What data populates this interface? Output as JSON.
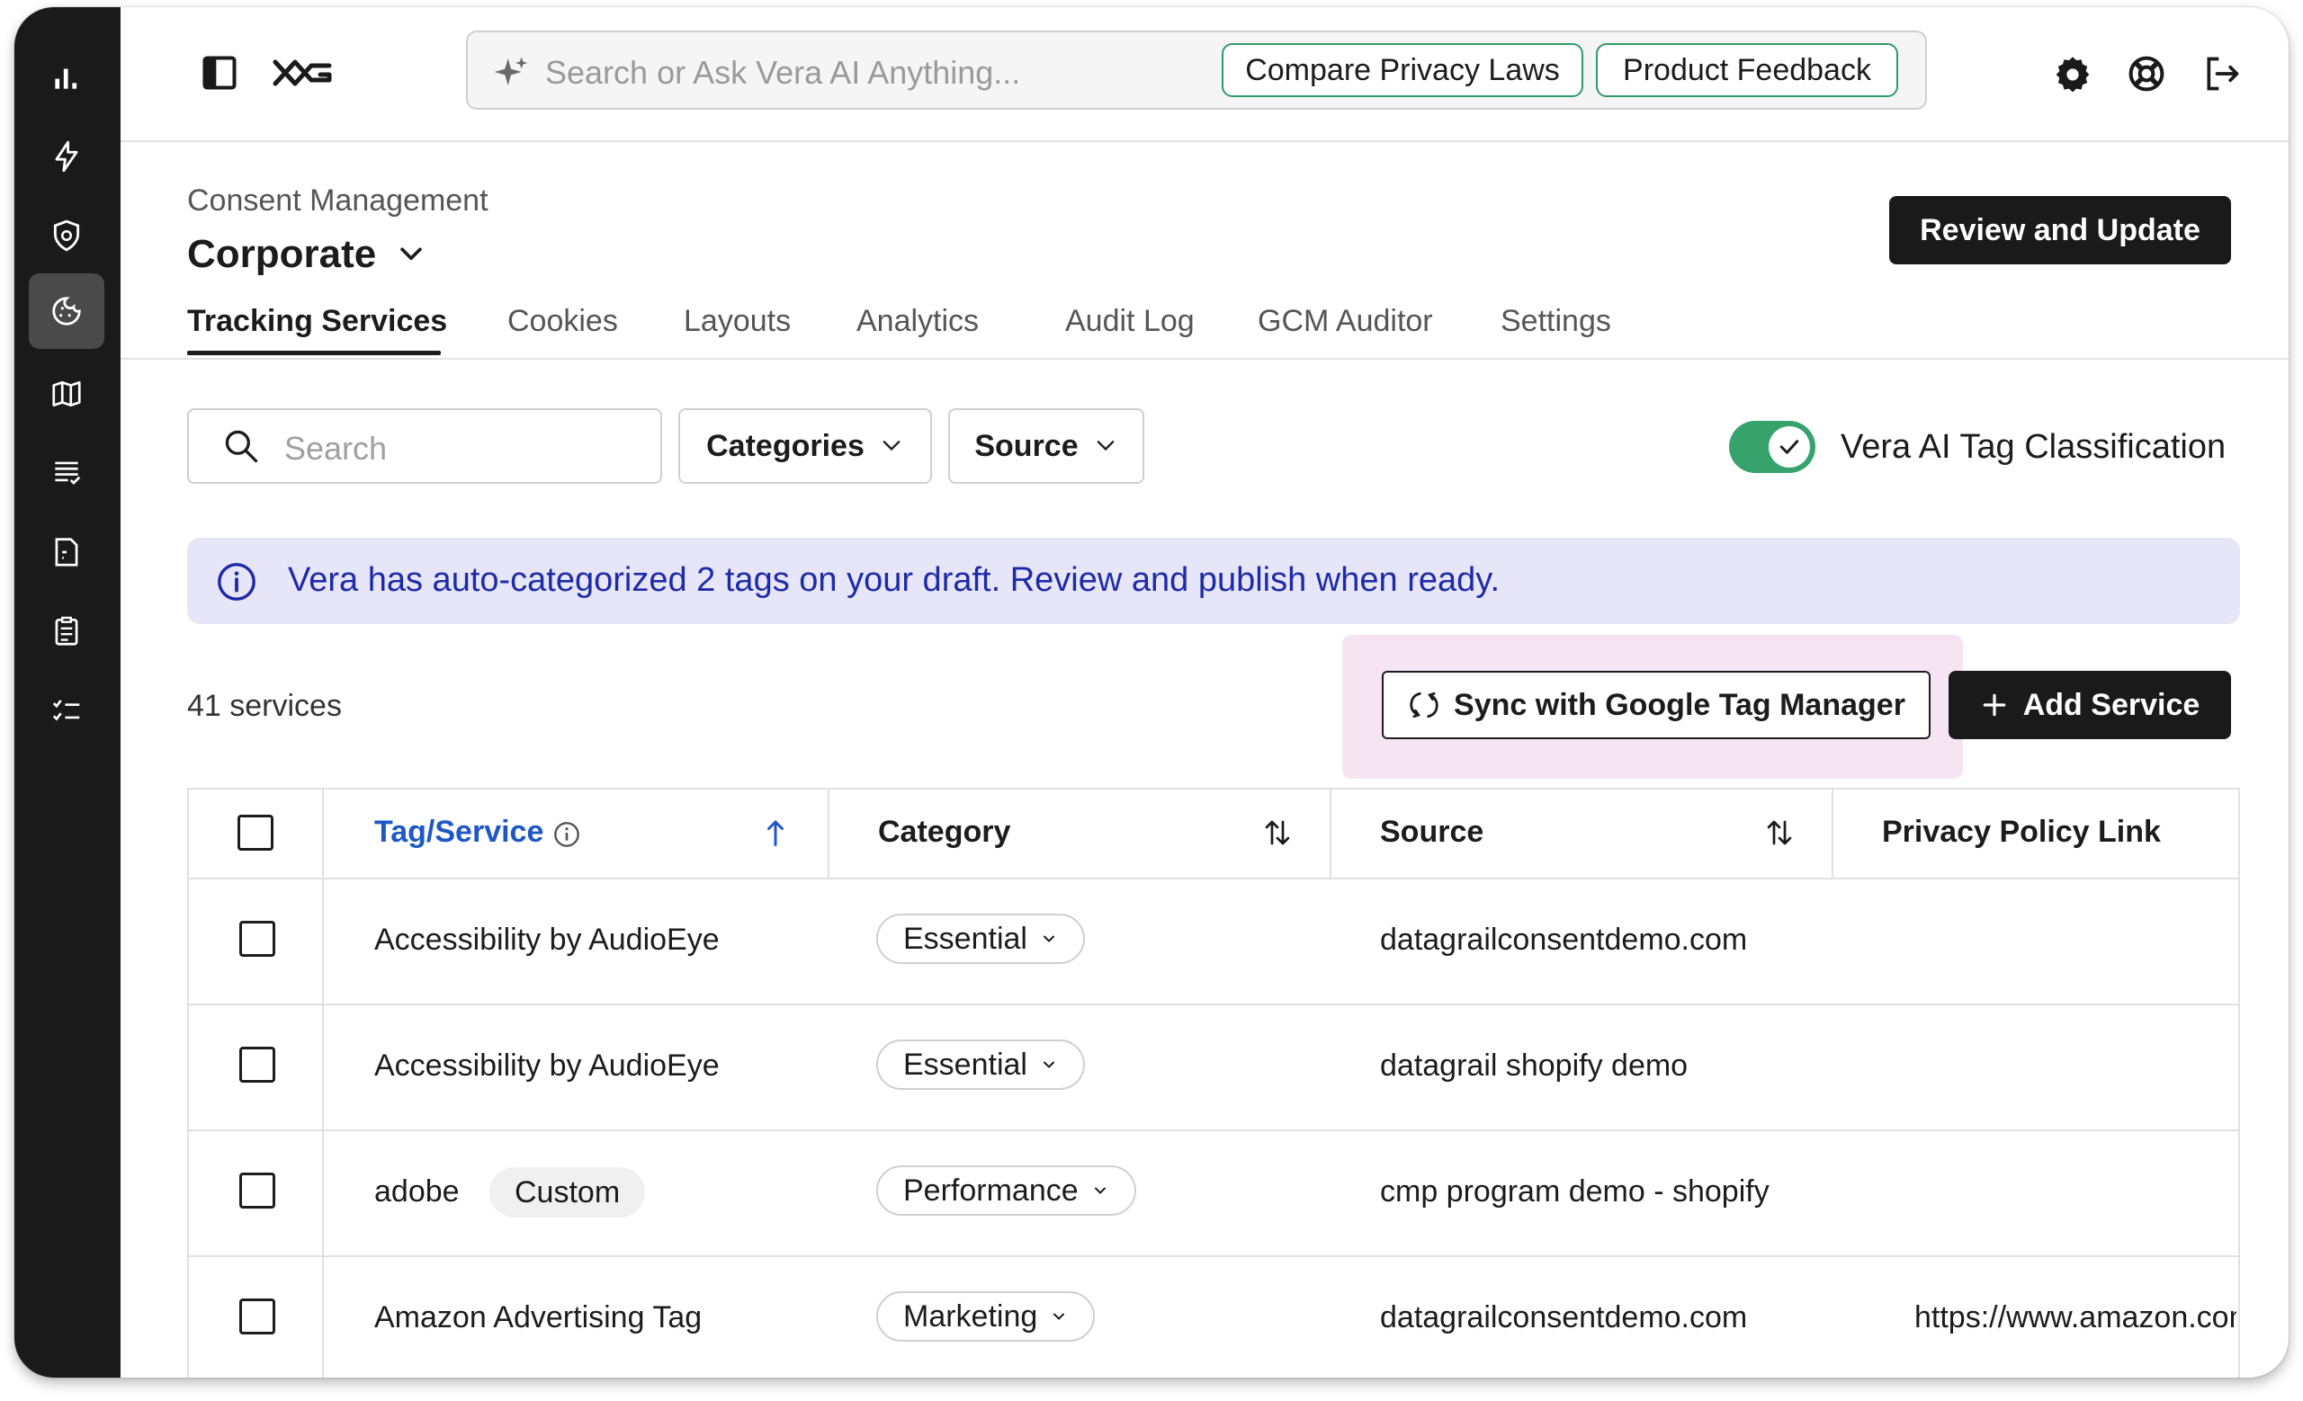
{
  "header": {
    "search_placeholder": "Search or Ask Vera AI Anything...",
    "compare_button": "Compare Privacy Laws",
    "feedback_button": "Product Feedback"
  },
  "page": {
    "breadcrumb": "Consent Management",
    "title": "Corporate",
    "review_button": "Review and Update",
    "tabs": [
      "Tracking Services",
      "Cookies",
      "Layouts",
      "Analytics",
      "Audit Log",
      "GCM Auditor",
      "Settings"
    ],
    "active_tab": "Tracking Services"
  },
  "filters": {
    "search_placeholder": "Search",
    "categories_label": "Categories",
    "source_label": "Source",
    "toggle_label": "Vera AI Tag Classification",
    "toggle_on": true
  },
  "banner": {
    "text": "Vera has auto-categorized 2 tags on your draft. Review and publish when ready."
  },
  "services": {
    "count_label": "41 services",
    "sync_button": "Sync with Google Tag Manager",
    "add_button": "Add Service"
  },
  "table": {
    "headers": {
      "tag_service": "Tag/Service",
      "category": "Category",
      "source": "Source",
      "privacy_policy": "Privacy Policy Link"
    },
    "rows": [
      {
        "name": "Accessibility by AudioEye",
        "tag": "",
        "category": "Essential",
        "source": "datagrailconsentdemo.com",
        "policy": ""
      },
      {
        "name": "Accessibility by AudioEye",
        "tag": "",
        "category": "Essential",
        "source": "datagrail shopify demo",
        "policy": ""
      },
      {
        "name": "adobe",
        "tag": "Custom",
        "category": "Performance",
        "source": "cmp program demo - shopify",
        "policy": ""
      },
      {
        "name": "Amazon Advertising Tag",
        "tag": "",
        "category": "Marketing",
        "source": "datagrailconsentdemo.com",
        "policy": "https://www.amazon.com"
      }
    ]
  },
  "colors": {
    "sidebar": "#1a1a1a",
    "accent_green": "#36a36d",
    "banner_bg": "#e6e6f8",
    "banner_text": "#1f2aa8",
    "sorted_header": "#1f58c4",
    "highlight": "#f6e4f2"
  },
  "icons": {
    "sidebar": [
      "bar-chart-icon",
      "lightning-icon",
      "shield-at-icon",
      "cookie-icon",
      "map-icon",
      "list-icon",
      "document-icon",
      "clipboard-icon",
      "checklist-icon"
    ],
    "header": [
      "sidebar-toggle-icon",
      "datagrail-logo-icon",
      "sparkle-icon",
      "gear-icon",
      "help-lifebuoy-icon",
      "logout-icon"
    ]
  }
}
